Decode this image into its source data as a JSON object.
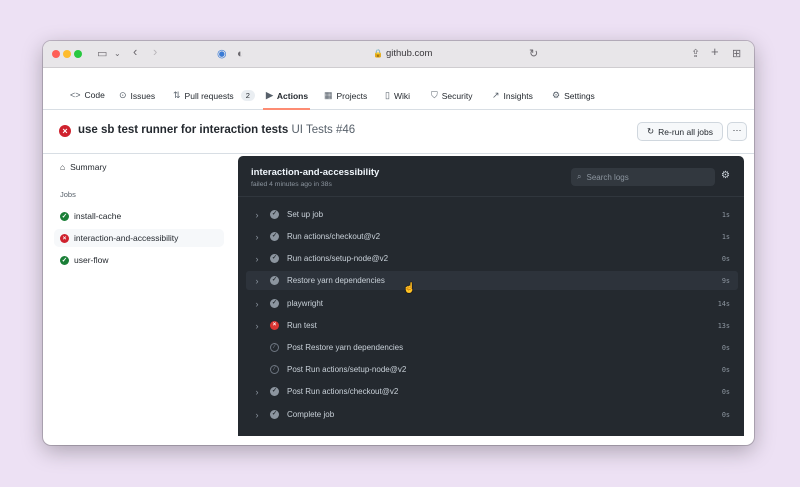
{
  "browser": {
    "url": "github.com"
  },
  "repo_nav": {
    "items": [
      {
        "label": "Code",
        "icon": "code-icon"
      },
      {
        "label": "Issues",
        "icon": "issue-icon"
      },
      {
        "label": "Pull requests",
        "icon": "pull-request-icon",
        "count": "2"
      },
      {
        "label": "Actions",
        "icon": "play-icon",
        "active": true
      },
      {
        "label": "Projects",
        "icon": "table-icon"
      },
      {
        "label": "Wiki",
        "icon": "book-icon"
      },
      {
        "label": "Security",
        "icon": "shield-icon"
      },
      {
        "label": "Insights",
        "icon": "graph-icon"
      },
      {
        "label": "Settings",
        "icon": "gear-icon"
      }
    ],
    "active_color": "#fd8c73"
  },
  "run": {
    "title": "use sb test runner for interaction tests",
    "workflow": "UI Tests #46",
    "rerun_label": "Re-run all jobs",
    "more_label": "···"
  },
  "sidebar": {
    "summary_label": "Summary",
    "jobs_heading": "Jobs",
    "jobs": [
      {
        "name": "install-cache",
        "status": "success"
      },
      {
        "name": "interaction-and-accessibility",
        "status": "failure"
      },
      {
        "name": "user-flow",
        "status": "success"
      }
    ]
  },
  "log_panel": {
    "title": "interaction-and-accessibility",
    "subtitle": "failed 4 minutes ago in 38s",
    "search_placeholder": "Search logs",
    "steps": [
      {
        "name": "Set up job",
        "status": "success",
        "duration": "1s"
      },
      {
        "name": "Run actions/checkout@v2",
        "status": "success",
        "duration": "1s"
      },
      {
        "name": "Run actions/setup-node@v2",
        "status": "success",
        "duration": "0s"
      },
      {
        "name": "Restore yarn dependencies",
        "status": "success",
        "duration": "9s",
        "hovered": true
      },
      {
        "name": "playwright",
        "status": "success",
        "duration": "14s"
      },
      {
        "name": "Run test",
        "status": "failure",
        "duration": "13s"
      },
      {
        "name": "Post Restore yarn dependencies",
        "status": "skipped",
        "duration": "0s"
      },
      {
        "name": "Post Run actions/setup-node@v2",
        "status": "skipped",
        "duration": "0s"
      },
      {
        "name": "Post Run actions/checkout@v2",
        "status": "success",
        "duration": "0s"
      },
      {
        "name": "Complete job",
        "status": "success",
        "duration": "0s"
      }
    ]
  },
  "colors": {
    "success": "#1a7f37",
    "failure": "#cf222e",
    "log_background": "#24292f"
  }
}
